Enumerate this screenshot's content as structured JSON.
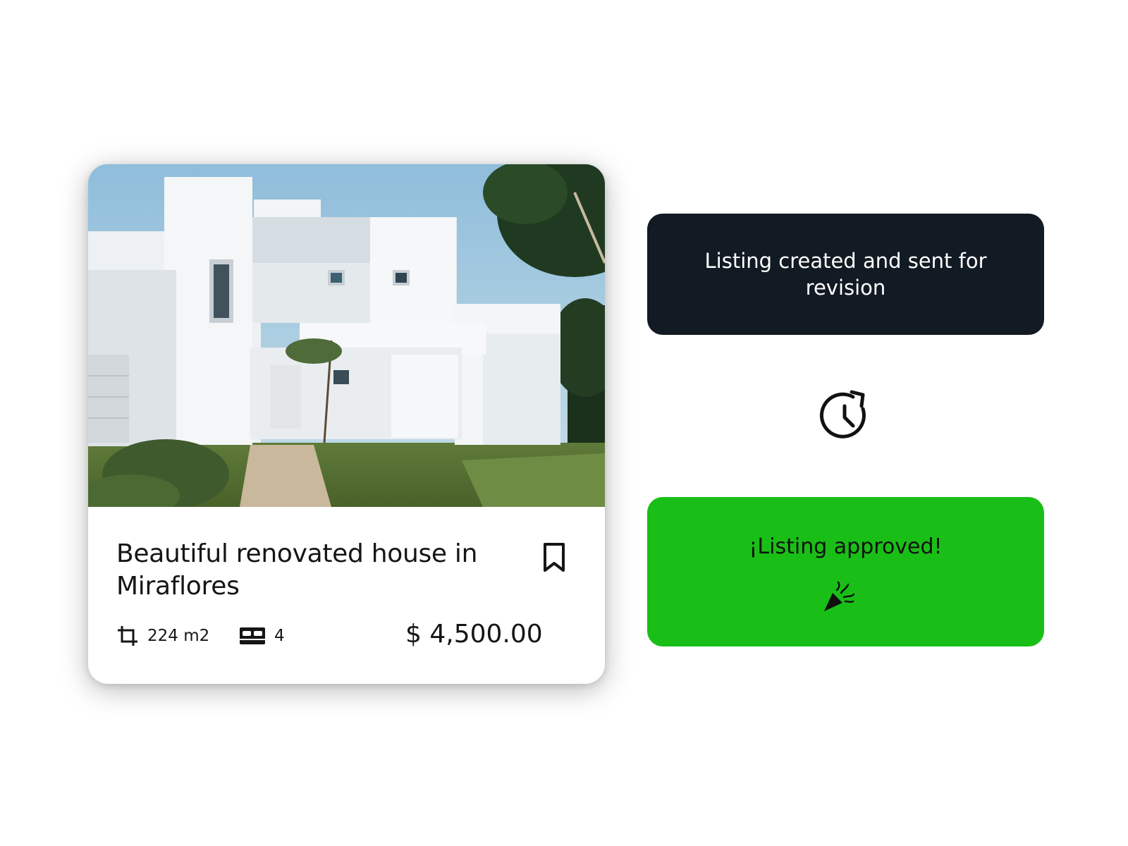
{
  "listing": {
    "title": "Beautiful renovated house in Miraflores",
    "area": "224 m2",
    "bedrooms": "4",
    "price": "$ 4,500.00",
    "image": "white-modern-house-photo"
  },
  "icons": {
    "bookmark": "bookmark-icon",
    "area": "crop-icon",
    "bedrooms": "bed-icon",
    "pending": "history-clock-icon",
    "approved": "party-popper-icon"
  },
  "status": {
    "pending_text": "Listing created and sent for revision",
    "approved_text": "¡Listing approved!"
  },
  "colors": {
    "pending_bg": "#121a23",
    "approved_bg": "#19bf17",
    "text_dark": "#151515"
  }
}
